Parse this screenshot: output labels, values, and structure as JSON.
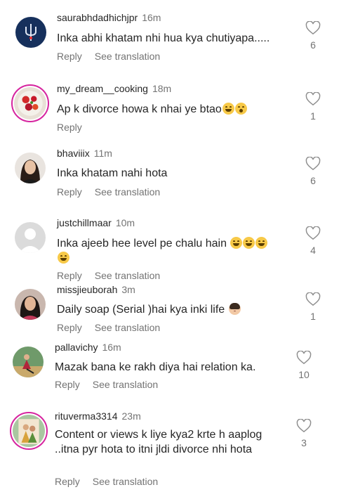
{
  "actions": {
    "reply": "Reply",
    "translate": "See translation"
  },
  "comments": [
    {
      "username": "saurabhdadhichjpr",
      "time": "16m",
      "text": "Inka abhi khatam nhi hua kya chutiyapa.....",
      "likes": "6",
      "avatar": "trident-avatar"
    },
    {
      "username": "my_dream__cooking",
      "time": "18m",
      "text": "Ap k divorce howa k nhai ye btao",
      "emojis": [
        "laughing-emoji",
        "astonished-emoji"
      ],
      "likes": "1",
      "avatar": "food-avatar"
    },
    {
      "username": "bhaviiix",
      "time": "11m",
      "text": "Inka khatam nahi hota",
      "likes": "6",
      "avatar": "portrait-avatar"
    },
    {
      "username": "justchillmaar",
      "time": "10m",
      "text": "Inka ajeeb hee level pe chalu hain",
      "emojis": [
        "laughing-emoji",
        "laughing-emoji",
        "laughing-emoji",
        "laughing-emoji"
      ],
      "likes": "4",
      "avatar": "default-avatar"
    },
    {
      "username": "missjieuborah",
      "time": "3m",
      "text": "Daily soap (Serial )hai kya inki life",
      "emojis": [
        "woman-emoji"
      ],
      "likes": "1",
      "avatar": "selfie-avatar"
    },
    {
      "username": "pallavichy",
      "time": "16m",
      "text": "Mazak bana ke rakh diya hai relation ka.",
      "likes": "10",
      "avatar": "outdoor-avatar"
    },
    {
      "username": "rituverma3314",
      "time": "23m",
      "text": "Content or views k liye kya2 krte h aaplog ..itna pyr hota to itni jldi divorce nhi hota",
      "likes": "3",
      "avatar": "group-avatar"
    }
  ]
}
